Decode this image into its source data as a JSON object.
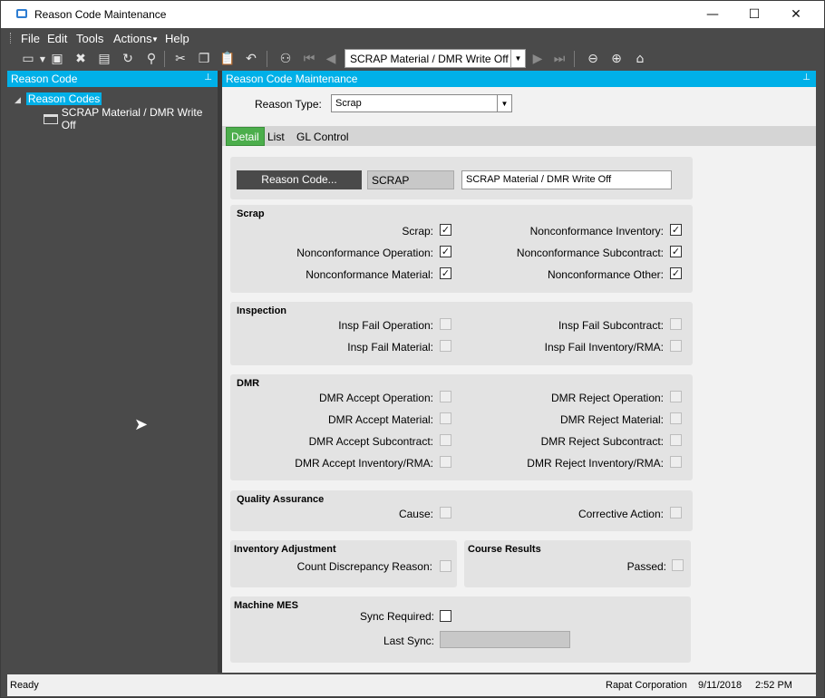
{
  "window": {
    "title": "Reason Code Maintenance",
    "minimize": "—",
    "maximize": "☐",
    "close": "✕"
  },
  "menu": [
    "File",
    "Edit",
    "Tools",
    "Actions",
    "Help"
  ],
  "nav_record": "SCRAP Material / DMR Write Off",
  "left_panel": {
    "title": "Reason Code",
    "tree_root": "Reason Codes",
    "tree_child": "SCRAP Material / DMR Write Off"
  },
  "right_panel": {
    "title": "Reason Code Maintenance",
    "reason_type_label": "Reason Type:",
    "reason_type_value": "Scrap",
    "tabs": [
      "Detail",
      "List",
      "GL Control"
    ],
    "reason_code_button": "Reason Code...",
    "reason_code": "SCRAP",
    "description": "SCRAP Material / DMR Write Off"
  },
  "groups": {
    "scrap": {
      "title": "Scrap",
      "left": [
        {
          "label": "Scrap:",
          "checked": true
        },
        {
          "label": "Nonconformance Operation:",
          "checked": true
        },
        {
          "label": "Nonconformance Material:",
          "checked": true
        }
      ],
      "right": [
        {
          "label": "Nonconformance Inventory:",
          "checked": true
        },
        {
          "label": "Nonconformance Subcontract:",
          "checked": true
        },
        {
          "label": "Nonconformance Other:",
          "checked": true
        }
      ]
    },
    "inspection": {
      "title": "Inspection",
      "left": [
        {
          "label": "Insp Fail Operation:",
          "checked": false
        },
        {
          "label": "Insp Fail Material:",
          "checked": false
        }
      ],
      "right": [
        {
          "label": "Insp Fail Subcontract:",
          "checked": false
        },
        {
          "label": "Insp Fail Inventory/RMA:",
          "checked": false
        }
      ]
    },
    "dmr": {
      "title": "DMR",
      "left": [
        {
          "label": "DMR Accept Operation:",
          "checked": false
        },
        {
          "label": "DMR Accept Material:",
          "checked": false
        },
        {
          "label": "DMR Accept Subcontract:",
          "checked": false
        },
        {
          "label": "DMR Accept Inventory/RMA:",
          "checked": false
        }
      ],
      "right": [
        {
          "label": "DMR Reject Operation:",
          "checked": false
        },
        {
          "label": "DMR Reject Material:",
          "checked": false
        },
        {
          "label": "DMR Reject Subcontract:",
          "checked": false
        },
        {
          "label": "DMR Reject Inventory/RMA:",
          "checked": false
        }
      ]
    },
    "qa": {
      "title": "Quality Assurance",
      "left": [
        {
          "label": "Cause:",
          "checked": false
        }
      ],
      "right": [
        {
          "label": "Corrective Action:",
          "checked": false
        }
      ]
    },
    "inventory": {
      "title": "Inventory Adjustment",
      "label": "Count Discrepancy Reason:",
      "checked": false
    },
    "course": {
      "title": "Course Results",
      "label": "Passed:",
      "checked": false
    },
    "mes": {
      "title": "Machine MES",
      "sync_label": "Sync Required:",
      "sync_checked": false,
      "last_sync_label": "Last Sync:",
      "last_sync_value": ""
    }
  },
  "status": {
    "text": "Ready",
    "company": "Rapat Corporation",
    "date": "9/11/2018",
    "time": "2:52 PM"
  }
}
